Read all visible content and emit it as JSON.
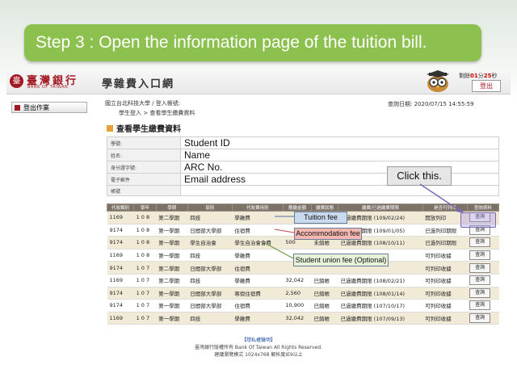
{
  "banner": {
    "text": "Step 3 : Open the information page of the tuition bill."
  },
  "header": {
    "logo_char": "臺",
    "bank_name_zh": "臺灣銀行",
    "bank_name_en": "BANK OF TAIWAN",
    "title": "學雜費入口網",
    "timer_prefix": "剩餘",
    "timer_minutes": "01",
    "timer_mid": "分",
    "timer_seconds": "25",
    "timer_suffix": "秒",
    "logout_label": "登出"
  },
  "sidebar": {
    "logout_label": "登出作業"
  },
  "breadcrumb": {
    "line1": "國立台北科技大學 / 登入帳號:",
    "line2": "學生登入 > 查看學生繳費資料",
    "query_date": "查詢日期: 2020/07/15 14:55:59"
  },
  "section_title": "查看學生繳費資料",
  "student_info": [
    {
      "label": "學號:",
      "value": "Student ID"
    },
    {
      "label": "姓名:",
      "value": "Name"
    },
    {
      "label": "身分證字號:",
      "value": "ARC No."
    },
    {
      "label": "電子郵件",
      "value": "Email address"
    },
    {
      "label": "帳號",
      "value": ""
    }
  ],
  "bill_table": {
    "headers": [
      "代收類別",
      "學年",
      "學期",
      "部別",
      "代收費用別",
      "應繳金額",
      "繳費狀態",
      "繳費/已過繳費期限",
      "是否可列印",
      "查詢資料"
    ],
    "rows": [
      [
        "1169",
        "1 0 8",
        "第二學期",
        "四技",
        "學雜費",
        "",
        "",
        "已過繳費期限 (109/02/24)",
        "開放列印",
        "查詢"
      ],
      [
        "9174",
        "1 0 8",
        "第一學期",
        "日間部大學部",
        "住宿費",
        "",
        "",
        "已過繳費期限 (109/01/05)",
        "已過列印期限",
        "查詢"
      ],
      [
        "9174",
        "1 0 8",
        "第一學期",
        "學生自治會",
        "學生自治會會費",
        "500",
        "未銷帳",
        "已過繳費期限 (108/10/11)",
        "已過列印期限",
        "查詢"
      ],
      [
        "1169",
        "1 0 8",
        "第一學期",
        "四技",
        "學雜費",
        "",
        "",
        "",
        "可列印收據",
        "查詢"
      ],
      [
        "9174",
        "1 0 7",
        "第二學期",
        "日間部大學部",
        "住宿費",
        "",
        "",
        "",
        "可列印收據",
        "查詢"
      ],
      [
        "1169",
        "1 0 7",
        "第二學期",
        "四技",
        "學雜費",
        "32,042",
        "已銷帳",
        "已過繳費期限 (108/02/21)",
        "可列印收據",
        "查詢"
      ],
      [
        "9174",
        "1 0 7",
        "第一學期",
        "日間部大學部",
        "寒假住宿費",
        "2,560",
        "已銷帳",
        "已過繳費期限 (108/01/14)",
        "可列印收據",
        "查詢"
      ],
      [
        "9174",
        "1 0 7",
        "第一學期",
        "日間部大學部",
        "住宿費",
        "10,900",
        "已銷帳",
        "已過繳費期限 (107/10/17)",
        "可列印收據",
        "查詢"
      ],
      [
        "1169",
        "1 0 7",
        "第一學期",
        "四技",
        "學雜費",
        "32,042",
        "已銷帳",
        "已過繳費期限 (107/09/13)",
        "可列印收據",
        "查詢"
      ]
    ]
  },
  "callouts": {
    "tuition": "Tuition fee",
    "accommodation": "Accommodation fee",
    "union": "Student union fee (Optional)",
    "click": "Click this."
  },
  "footer": {
    "privacy": "【隱私權聲明】",
    "copyright": "臺灣銀行版權所有 Bank Of Taiwan All Rights Reserved.",
    "browser": "建議瀏覽模式 1024x768 解析度IE9以上"
  },
  "colors": {
    "banner": "#8dc14f",
    "brand": "#a31923",
    "table_header": "#7c7268",
    "row_alt": "#f1ead7"
  }
}
